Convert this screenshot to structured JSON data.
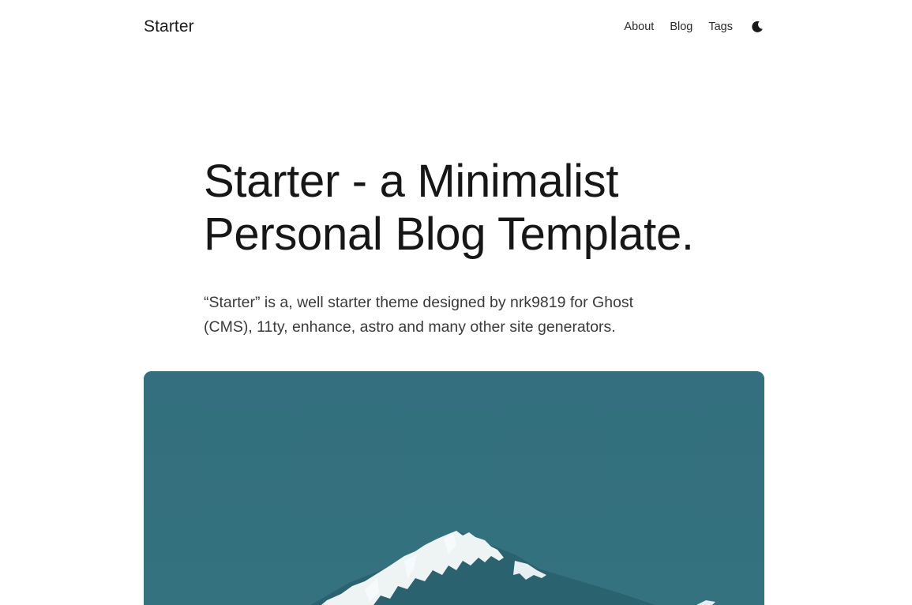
{
  "header": {
    "logo": "Starter",
    "nav": {
      "about": "About",
      "blog": "Blog",
      "tags": "Tags"
    },
    "theme_toggle_icon": "moon-icon"
  },
  "hero": {
    "title_line1": "Starter - a Minimalist",
    "title_line2": "Personal Blog Template.",
    "description_line1": "“Starter” is a, well starter theme designed by nrk9819 for Ghost",
    "description_line2": "(CMS), 11ty, enhance, astro and many other site generators."
  },
  "featured_image": {
    "subject": "snow-capped mountain peak against teal sky",
    "background_color": "#337180",
    "snow_color": "#f2f6f7"
  }
}
